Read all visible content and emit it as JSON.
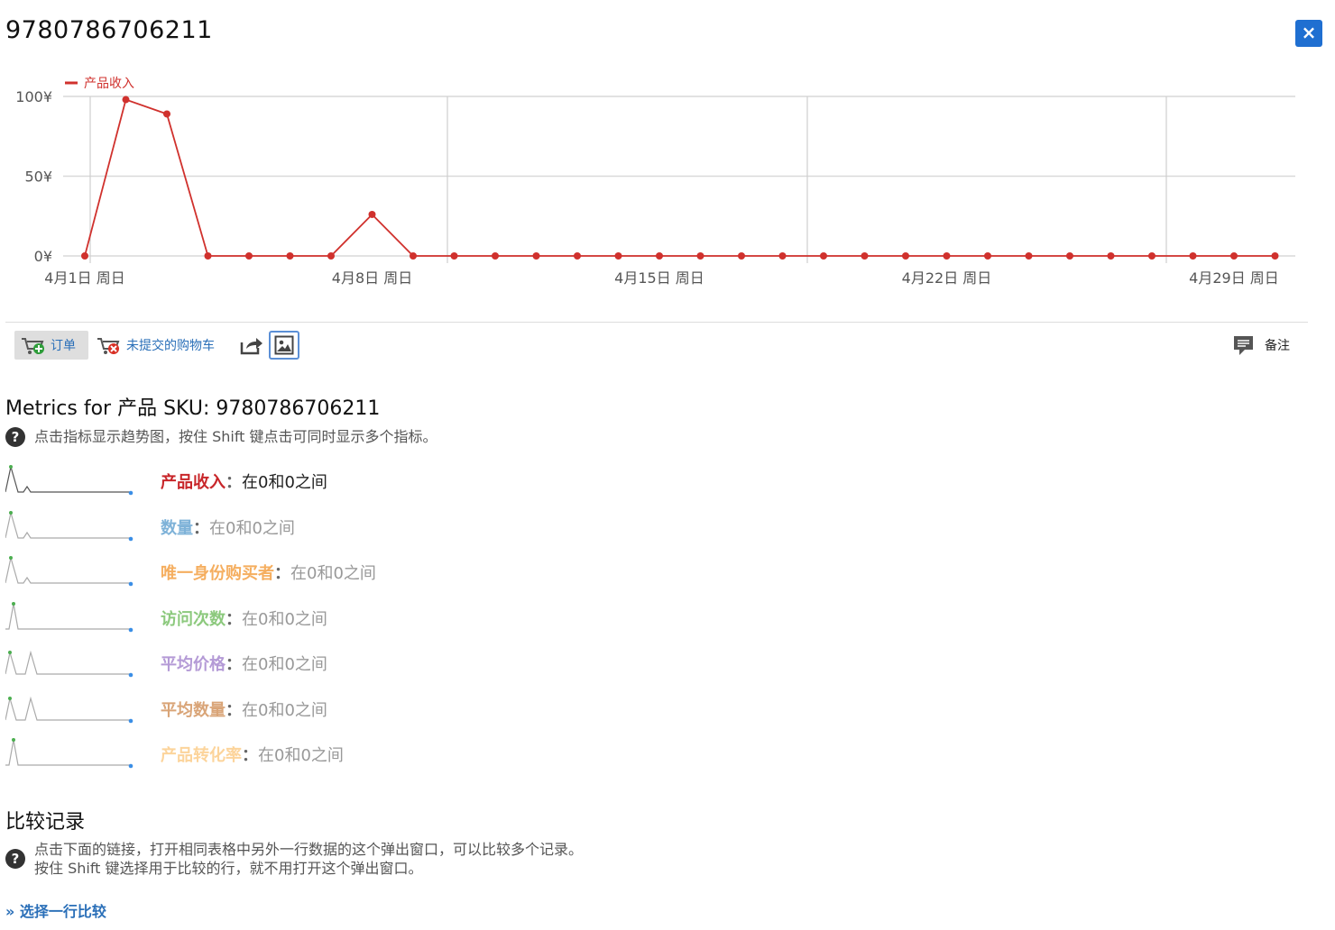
{
  "title": "9780786706211",
  "close_label": "×",
  "chart_data": {
    "type": "line",
    "series": [
      {
        "name": "产品收入",
        "color": "#d0312d",
        "values": [
          0,
          98,
          89,
          0,
          0,
          0,
          0,
          26,
          0,
          0,
          0,
          0,
          0,
          0,
          0,
          0,
          0,
          0,
          0,
          0,
          0,
          0,
          0,
          0,
          0,
          0,
          0,
          0,
          0,
          0
        ]
      }
    ],
    "x_tick_labels": [
      "4月1日 周日",
      "4月8日 周日",
      "4月15日 周日",
      "4月22日 周日",
      "4月29日 周日"
    ],
    "y_tick_labels": [
      "0¥",
      "50¥",
      "100¥"
    ],
    "ylim": [
      0,
      100
    ],
    "legend_position": "top-left",
    "grid": true
  },
  "toolbar": {
    "orders_label": "订单",
    "cart_label": "未提交的购物车",
    "notes_label": "备注"
  },
  "metrics_section": {
    "heading": "Metrics for 产品 SKU: 9780786706211",
    "help": "点击指标显示趋势图，按住 Shift 键点击可同时显示多个指标。",
    "separator": "：",
    "items": [
      {
        "name": "产品收入",
        "range": "在0和0之间",
        "color": "#c8262a"
      },
      {
        "name": "数量",
        "range": "在0和0之间",
        "color": "#7eb2d8"
      },
      {
        "name": "唯一身份购买者",
        "range": "在0和0之间",
        "color": "#f5ae5f"
      },
      {
        "name": "访问次数",
        "range": "在0和0之间",
        "color": "#8cc97d"
      },
      {
        "name": "平均价格",
        "range": "在0和0之间",
        "color": "#b49ad6"
      },
      {
        "name": "平均数量",
        "range": "在0和0之间",
        "color": "#d9a477"
      },
      {
        "name": "产品转化率",
        "range": "在0和0之间",
        "color": "#fcd49b"
      }
    ]
  },
  "compare_section": {
    "heading": "比较记录",
    "help_line1": "点击下面的链接，打开相同表格中另外一行数据的这个弹出窗口，可以比较多个记录。",
    "help_line2": "按住 Shift 键选择用于比较的行，就不用打开这个弹出窗口。",
    "link_label": "» 选择一行比较"
  }
}
